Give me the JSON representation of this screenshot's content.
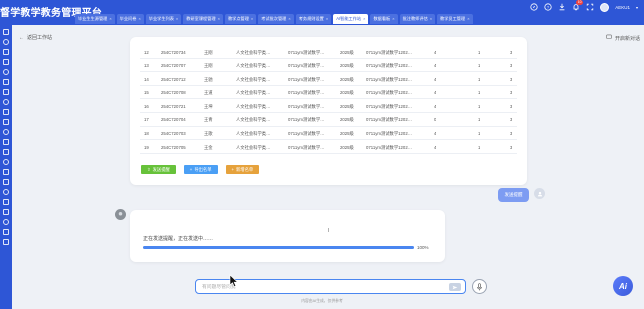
{
  "app": {
    "title": "督学教学教务管理平台"
  },
  "tabs": [
    {
      "label": "毕业生生源管理"
    },
    {
      "label": "毕业问卷"
    },
    {
      "label": "毕业学生列表"
    },
    {
      "label": "教研室课程管理"
    },
    {
      "label": "教学点管理"
    },
    {
      "label": "考试批次管理"
    },
    {
      "label": "考务规则设置"
    },
    {
      "label": "AI智能工作站",
      "active": true
    },
    {
      "label": "数据看板"
    },
    {
      "label": "批注教师评估"
    },
    {
      "label": "教学员工管理"
    }
  ],
  "header": {
    "notification_count": "10",
    "username": "AEKU1"
  },
  "nav": {
    "back_label": "返回工作站",
    "open_workspace_label": "开启新对话"
  },
  "table": {
    "rows": [
      [
        "12",
        "254C720734",
        "王刚",
        "人文社会科学类…",
        "0711ym测试数学…",
        "2025级",
        "0711ym测试数学1202…",
        "4",
        "1",
        "3"
      ],
      [
        "13",
        "254C720707",
        "王刚",
        "人文社会科学类…",
        "0711ym测试数学…",
        "2025级",
        "0711ym测试数学1202…",
        "4",
        "1",
        "3"
      ],
      [
        "14",
        "254C720712",
        "王驰",
        "人文社会科学类…",
        "0711ym测试数学…",
        "2025级",
        "0711ym测试数学1202…",
        "4",
        "1",
        "3"
      ],
      [
        "15",
        "254C720708",
        "王道",
        "人文社会科学类…",
        "0711ym测试数学…",
        "2025级",
        "0711ym测试数学1202…",
        "4",
        "1",
        "3"
      ],
      [
        "16",
        "254C720721",
        "王坤",
        "人文社会科学类…",
        "0711ym测试数学…",
        "2025级",
        "0711ym测试数学1202…",
        "4",
        "1",
        "3"
      ],
      [
        "17",
        "254C720704",
        "王青",
        "人文社会科学类…",
        "0711ym测试数学…",
        "2025级",
        "0711ym测试数学1202…",
        "0",
        "1",
        "3"
      ],
      [
        "18",
        "254C720703",
        "王歌",
        "人文社会科学类…",
        "0711ym测试数学…",
        "2025级",
        "0711ym测试数学1202…",
        "4",
        "1",
        "3"
      ],
      [
        "19",
        "254C720705",
        "王金",
        "人文社会科学类…",
        "0711ym测试数学…",
        "2025级",
        "0711ym测试数学1202…",
        "4",
        "1",
        "3"
      ]
    ]
  },
  "actions": {
    "send_reminder": "发送提醒",
    "export_list": "导出名单",
    "add_list": "新增名单"
  },
  "chat": {
    "user_message": "发送提醒",
    "progress_text": "正在发送提醒，正在发送中……",
    "progress_percent": "100%",
    "progress_value": 100,
    "input_placeholder": "有问题尽管问我",
    "footer": "内容由AI生成，仅供参考",
    "ai_fab_label": "Ai"
  },
  "colors": {
    "primary": "#2e56d6",
    "success": "#67c23a",
    "info": "#4a9ff5",
    "warning": "#e6a23c"
  }
}
